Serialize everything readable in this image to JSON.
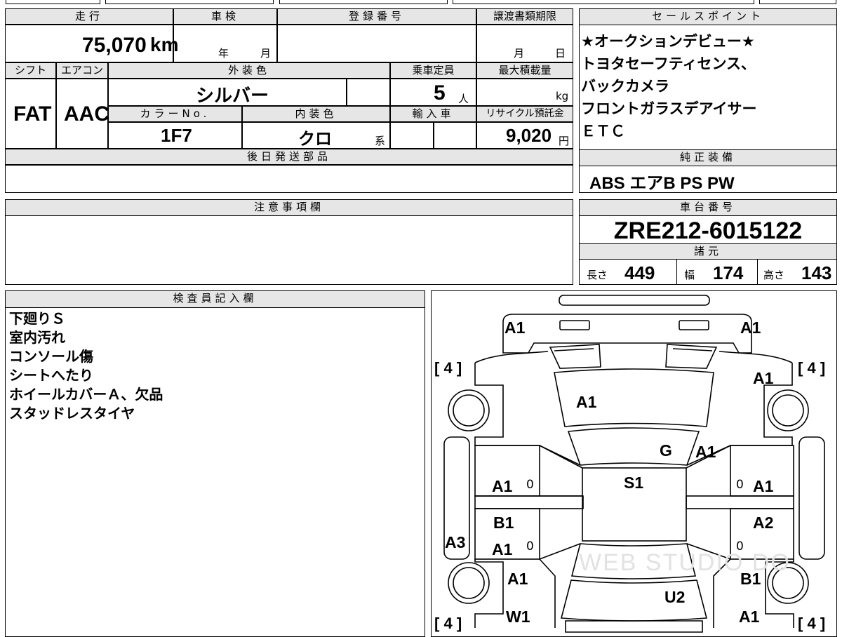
{
  "top": {
    "mileage_label": "走行",
    "mileage_value": "75,070",
    "mileage_unit": "km",
    "inspection_label": "車検",
    "inspection_year": "年",
    "inspection_month": "月",
    "registration_label": "登録番号",
    "transfer_label": "譲渡書類期限",
    "transfer_month": "月",
    "transfer_day": "日",
    "shift_label": "シフト",
    "shift_value": "FAT",
    "ac_label": "エアコン",
    "ac_value": "AAC",
    "exterior_label": "外装色",
    "exterior_value": "シルバー",
    "capacity_label": "乗車定員",
    "capacity_value": "5",
    "capacity_unit": "人",
    "maxload_label": "最大積載量",
    "maxload_unit": "kg",
    "color_no_label": "カラーNo.",
    "color_no_value": "1F7",
    "interior_label": "内装色",
    "interior_value": "クロ",
    "interior_suffix": "系",
    "import_label": "輸入車",
    "recycle_label": "リサイクル預託金",
    "recycle_value": "9,020",
    "recycle_unit": "円",
    "later_parts_label": "後日発送部品"
  },
  "sales_points": {
    "title": "セールスポイント",
    "lines": [
      "★オークションデビュー★",
      "トヨタセーフティセンス、",
      "バックカメラ",
      "フロントガラスデアイサー",
      "ＥＴＣ"
    ]
  },
  "genuine": {
    "title": "純正装備",
    "value": "ABS エアB PS PW"
  },
  "notes": {
    "title": "注意事項欄"
  },
  "chassis": {
    "title": "車台番号",
    "value": "ZRE212-6015122",
    "spec_title": "諸元",
    "length_label": "長さ",
    "length_value": "449",
    "width_label": "幅",
    "width_value": "174",
    "height_label": "高さ",
    "height_value": "143"
  },
  "inspector": {
    "title": "検査員記入欄",
    "lines": [
      "下廻りＳ",
      "室内汚れ",
      "コンソール傷",
      "シートへたり",
      "ホイールカバーＡ、欠品",
      "スタッドレスタイヤ"
    ]
  },
  "diagram": {
    "marks": {
      "front_left": "A1",
      "front_right": "A1",
      "fender_right": "A1",
      "hood": "A1",
      "glass": "G",
      "pillar_right": "A1",
      "roof": "S1",
      "door_fl": "A1",
      "door_fr": "A1",
      "door_rl_top": "B1",
      "door_rr": "A2",
      "sill_left": "A3",
      "door_rl": "A1",
      "quarter_left": "A1",
      "quarter_right": "B1",
      "trunk": "U2",
      "wheel_rl": "W1",
      "rear_right": "A1"
    },
    "zeros": [
      "0",
      "0",
      "0",
      "0"
    ],
    "tires": {
      "fl": "4",
      "fr": "4",
      "rl": "4",
      "rr": "4"
    },
    "watermark": "WEB STUDIO DO"
  }
}
